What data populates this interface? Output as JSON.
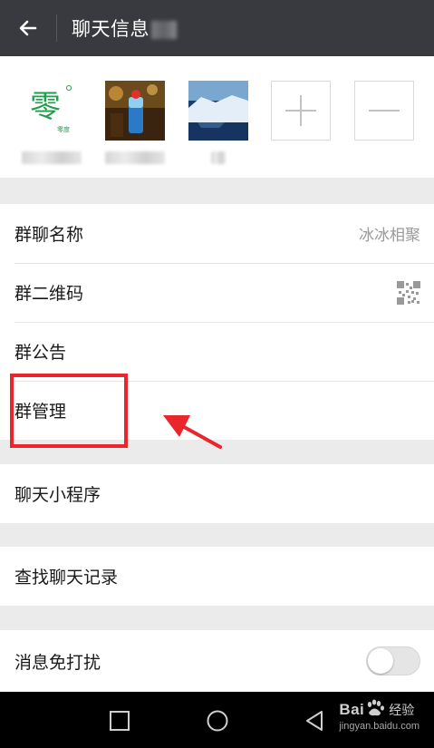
{
  "header": {
    "back_icon": "arrow-left-icon",
    "title": "聊天信息"
  },
  "members": {
    "add_icon": "plus-icon",
    "remove_icon": "minus-icon"
  },
  "settings": {
    "group_name_label": "群聊名称",
    "group_name_value": "冰冰相聚",
    "qr_label": "群二维码",
    "qr_icon": "qr-code-icon",
    "notice_label": "群公告",
    "manage_label": "群管理",
    "mini_program_label": "聊天小程序",
    "search_history_label": "查找聊天记录",
    "mute_label": "消息免打扰",
    "mute_enabled": false
  },
  "annotation": {
    "color": "#e8262b"
  },
  "watermark": {
    "brand": "Bai",
    "brand_suffix": "经验",
    "url": "jingyan.baidu.com"
  },
  "navbar": {
    "square_icon": "recent-apps-icon",
    "circle_icon": "home-icon",
    "triangle_icon": "back-icon"
  }
}
